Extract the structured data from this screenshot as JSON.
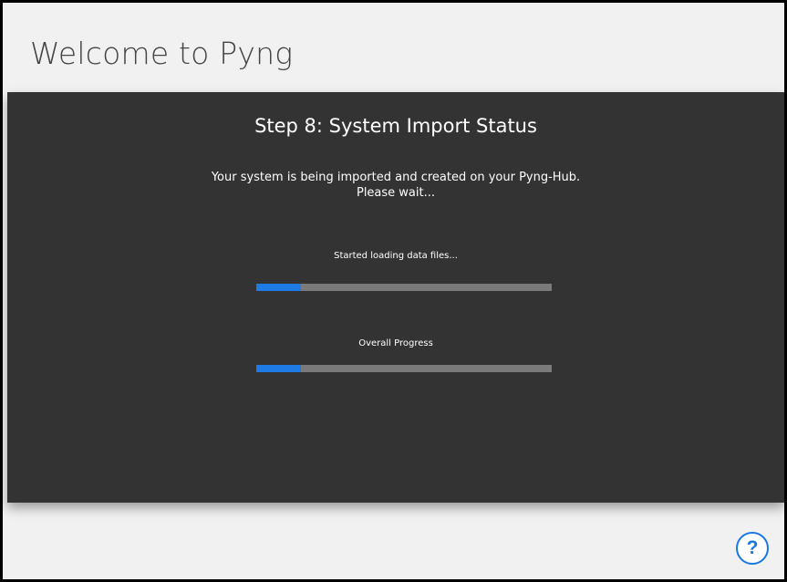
{
  "app": {
    "title": "Welcome to Pyng"
  },
  "panel": {
    "step_title": "Step 8: System Import Status",
    "message_line1": "Your system is being imported and created on your Pyng-Hub.",
    "message_line2": "Please wait..."
  },
  "progress": [
    {
      "label": "Started loading data files...",
      "percent": 15
    },
    {
      "label": "Overall Progress",
      "percent": 15
    }
  ],
  "help": {
    "icon": "question-mark-icon",
    "symbol": "?"
  },
  "colors": {
    "accent": "#1e7be6",
    "panel": "#333333",
    "background": "#f1f1f1"
  }
}
